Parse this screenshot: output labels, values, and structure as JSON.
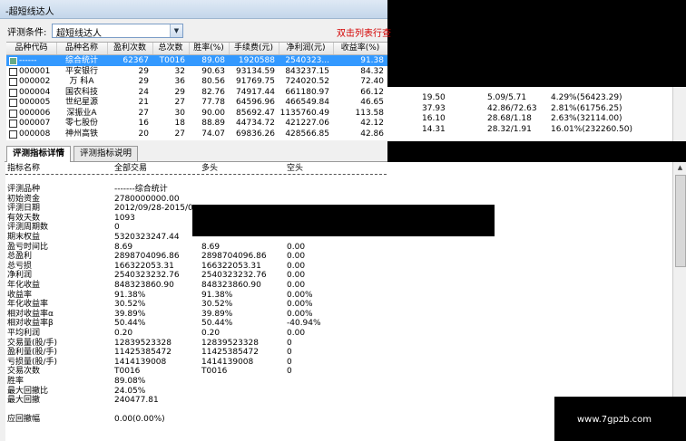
{
  "window": {
    "title": "-超短线达人"
  },
  "condition": {
    "label": "评测条件:",
    "selected": "超短线达人",
    "hint": "双击列表行查"
  },
  "grid": {
    "columns": [
      "品种代码",
      "品种名称",
      "盈利次数",
      "总次数",
      "胜率(%)",
      "手续费(元)",
      "净利润(元)",
      "收益率(%)"
    ],
    "rows": [
      {
        "code": "------",
        "name": "综合统计",
        "win": "62367",
        "total": "T0016",
        "rate": "89.08",
        "fee": "1920588",
        "profit": "2540323...",
        "ret": "91.38",
        "selected": true
      },
      {
        "code": "000001",
        "name": "平安银行",
        "win": "29",
        "total": "32",
        "rate": "90.63",
        "fee": "93134.59",
        "profit": "843237.15",
        "ret": "84.32"
      },
      {
        "code": "000002",
        "name": "万 科A",
        "win": "29",
        "total": "36",
        "rate": "80.56",
        "fee": "91769.75",
        "profit": "724020.52",
        "ret": "72.40"
      },
      {
        "code": "000004",
        "name": "国农科技",
        "win": "24",
        "total": "29",
        "rate": "82.76",
        "fee": "74917.44",
        "profit": "661180.97",
        "ret": "66.12"
      },
      {
        "code": "000005",
        "name": "世纪星源",
        "win": "21",
        "total": "27",
        "rate": "77.78",
        "fee": "64596.96",
        "profit": "466549.84",
        "ret": "46.65"
      },
      {
        "code": "000006",
        "name": "深振业A",
        "win": "27",
        "total": "30",
        "rate": "90.00",
        "fee": "85692.47",
        "profit": "1135760.49",
        "ret": "113.58"
      },
      {
        "code": "000007",
        "name": "零七股份",
        "win": "16",
        "total": "18",
        "rate": "88.89",
        "fee": "44734.72",
        "profit": "421227.06",
        "ret": "42.12"
      },
      {
        "code": "000008",
        "name": "神州高铁",
        "win": "20",
        "total": "27",
        "rate": "74.07",
        "fee": "69836.26",
        "profit": "428566.85",
        "ret": "42.86"
      }
    ],
    "extra_rows": [
      {
        "a": "19.50",
        "b": "5.09/5.71",
        "c": "4.29%(56423.29)"
      },
      {
        "a": "37.93",
        "b": "42.86/72.63",
        "c": "2.81%(61756.25)"
      },
      {
        "a": "16.10",
        "b": "28.68/1.18",
        "c": "2.63%(32114.00)"
      },
      {
        "a": "14.31",
        "b": "28.32/1.91",
        "c": "16.01%(232260.50)"
      }
    ]
  },
  "tabs": [
    "评测指标详情",
    "评测指标说明"
  ],
  "detail": {
    "headers": [
      "指标名称",
      "全部交易",
      "多头",
      "空头"
    ],
    "rows": [
      {
        "k": "评测品种",
        "all": "-------综合统计",
        "long": "",
        "short": ""
      },
      {
        "k": "初始资金",
        "all": "2780000000.00",
        "long": "",
        "short": ""
      },
      {
        "k": "评测日期",
        "all": "2012/09/28-2015/0",
        "long": "",
        "short": ""
      },
      {
        "k": "有效天数",
        "all": "1093",
        "long": "",
        "short": ""
      },
      {
        "k": "评测周期数",
        "all": "0",
        "long": "",
        "short": ""
      },
      {
        "k": "期末权益",
        "all": "5320323247.44",
        "long": "",
        "short": ""
      },
      {
        "k": "盈亏时间比",
        "all": "8.69",
        "long": "8.69",
        "short": "0.00"
      },
      {
        "k": "总盈利",
        "all": "2898704096.86",
        "long": "2898704096.86",
        "short": "0.00"
      },
      {
        "k": "总亏损",
        "all": "166322053.31",
        "long": "166322053.31",
        "short": "0.00"
      },
      {
        "k": "净利润",
        "all": "2540323232.76",
        "long": "2540323232.76",
        "short": "0.00"
      },
      {
        "k": "年化收益",
        "all": "848323860.90",
        "long": "848323860.90",
        "short": "0.00"
      },
      {
        "k": "收益率",
        "all": "91.38%",
        "long": "91.38%",
        "short": "0.00%"
      },
      {
        "k": "年化收益率",
        "all": "30.52%",
        "long": "30.52%",
        "short": "0.00%"
      },
      {
        "k": "相对收益率α",
        "all": "39.89%",
        "long": " 39.89%",
        "short": "  0.00%"
      },
      {
        "k": "相对收益率β",
        "all": "50.44%",
        "long": " 50.44%",
        "short": " -40.94%"
      },
      {
        "k": "平均利润",
        "all": "0.20",
        "long": "0.20",
        "short": "0.00"
      },
      {
        "k": "交易量(股/手)",
        "all": "12839523328",
        "long": "12839523328",
        "short": "0"
      },
      {
        "k": "盈利量(股/手)",
        "all": "11425385472",
        "long": "11425385472",
        "short": "0"
      },
      {
        "k": "亏损量(股/手)",
        "all": "1414139008",
        "long": "1414139008",
        "short": "0"
      },
      {
        "k": "交易次数",
        "all": "T0016",
        "long": "T0016",
        "short": "0"
      },
      {
        "k": "胜率",
        "all": "89.08%",
        "long": "",
        "short": ""
      },
      {
        "k": "最大回撤比",
        "all": "24.05%",
        "long": "",
        "short": ""
      },
      {
        "k": "最大回撤",
        "all": "240477.81",
        "long": "",
        "short": ""
      },
      {
        "k": "",
        "all": "",
        "long": "",
        "short": ""
      },
      {
        "k": "应回撤幅",
        "all": "0.00(0.00%)",
        "long": "",
        "short": ""
      }
    ]
  },
  "watermark": "www.7gpzb.com"
}
